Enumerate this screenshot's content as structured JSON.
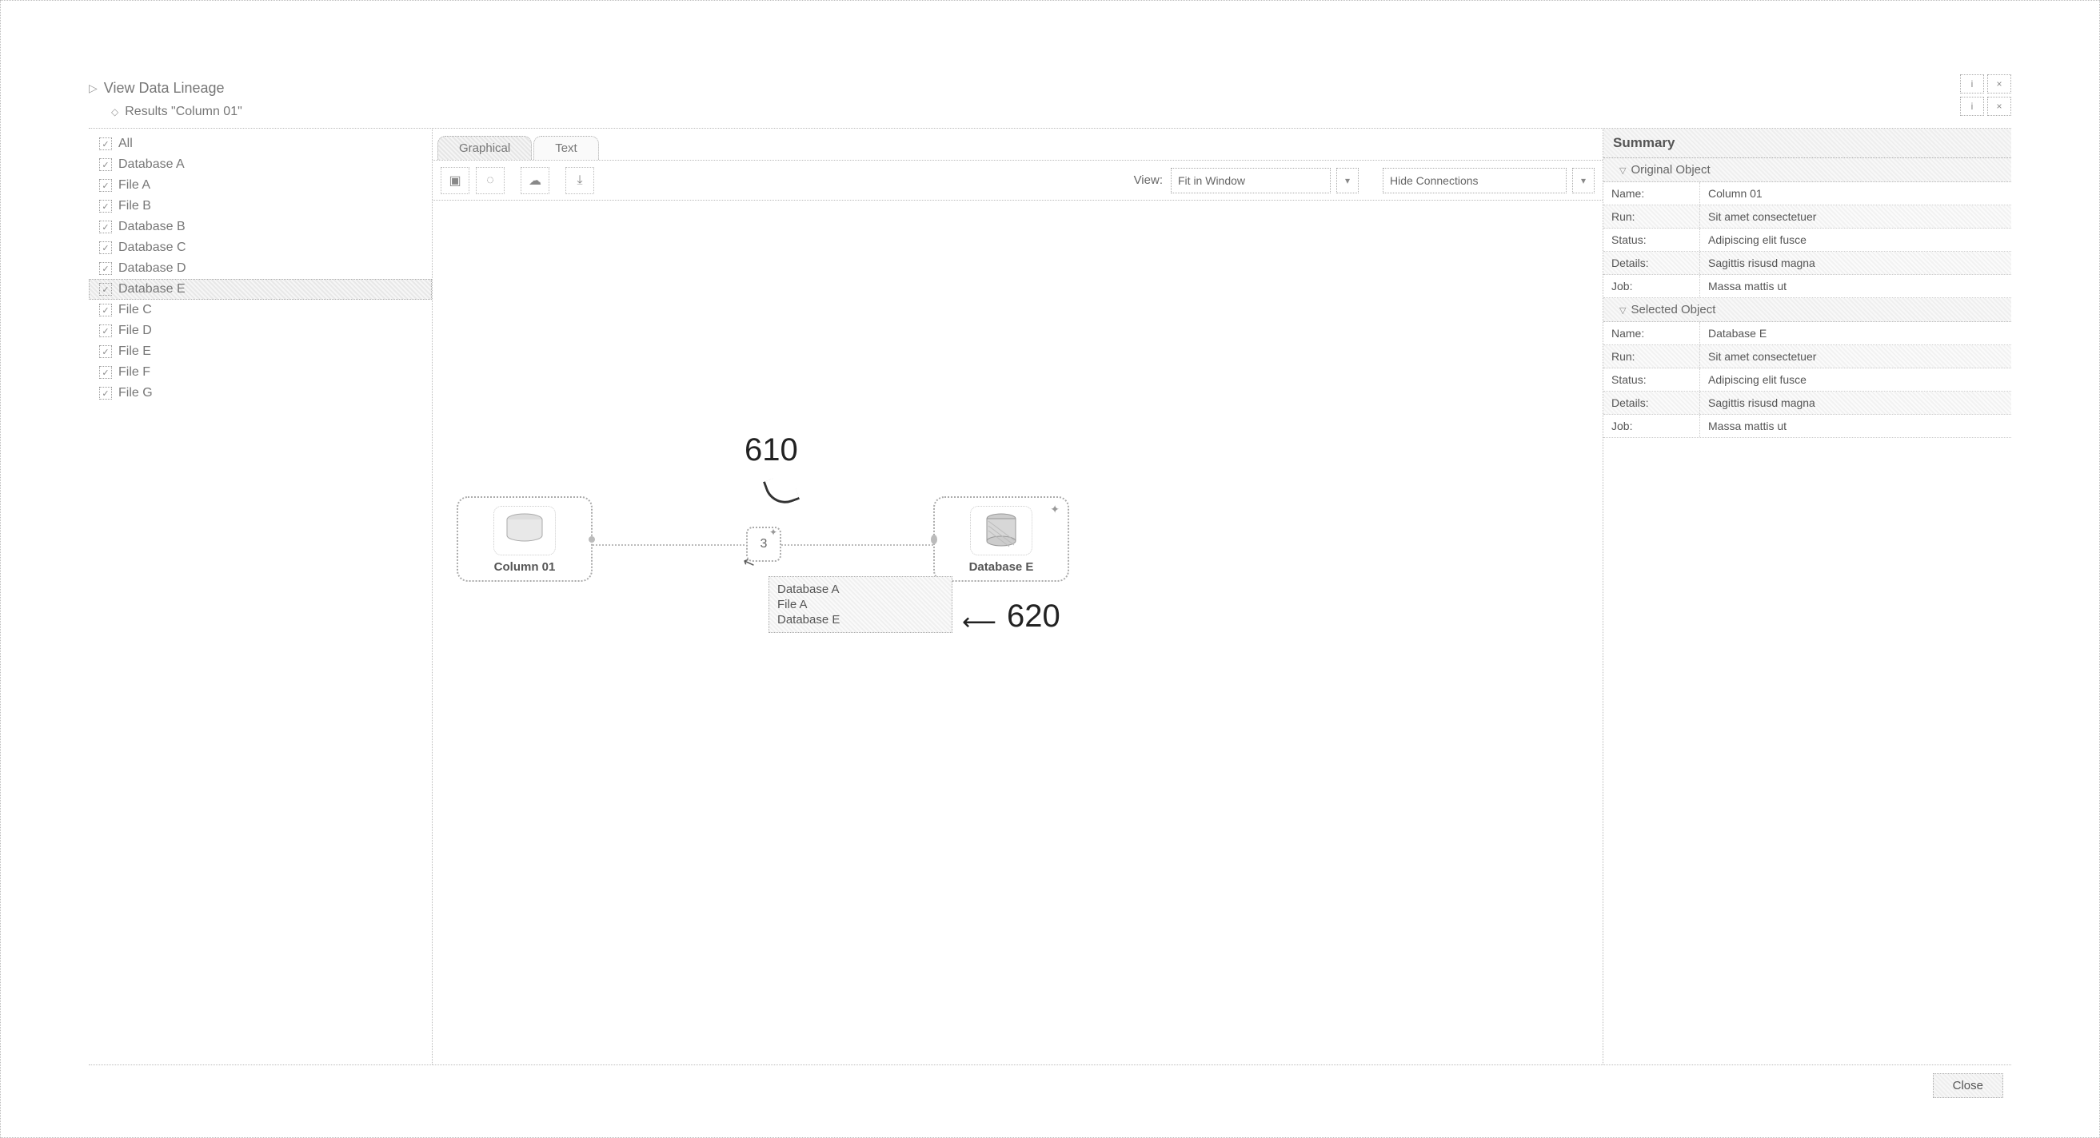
{
  "header": {
    "title": "View Data Lineage",
    "subtitle": "Results \"Column 01\"",
    "info_label": "i",
    "close_label": "×"
  },
  "sidebar": {
    "items": [
      {
        "label": "All",
        "checked": true,
        "selected": false
      },
      {
        "label": "Database A",
        "checked": true,
        "selected": false
      },
      {
        "label": "File A",
        "checked": true,
        "selected": false
      },
      {
        "label": "File B",
        "checked": true,
        "selected": false
      },
      {
        "label": "Database B",
        "checked": true,
        "selected": false
      },
      {
        "label": "Database C",
        "checked": true,
        "selected": false
      },
      {
        "label": "Database D",
        "checked": true,
        "selected": false
      },
      {
        "label": "Database E",
        "checked": true,
        "selected": true
      },
      {
        "label": "File C",
        "checked": true,
        "selected": false
      },
      {
        "label": "File D",
        "checked": true,
        "selected": false
      },
      {
        "label": "File E",
        "checked": true,
        "selected": false
      },
      {
        "label": "File F",
        "checked": true,
        "selected": false
      },
      {
        "label": "File G",
        "checked": true,
        "selected": false
      }
    ]
  },
  "tabs": {
    "graphical": "Graphical",
    "text": "Text"
  },
  "toolbar": {
    "view_label": "View:",
    "view_value": "Fit in Window",
    "hide_conn_label": "Hide Connections"
  },
  "graph": {
    "node_left_label": "Column 01",
    "hop_count": "3",
    "node_right_label": "Database E",
    "popup_items": [
      "Database A",
      "File A",
      "Database E"
    ]
  },
  "callouts": {
    "c1": "610",
    "c2": "620"
  },
  "summary": {
    "title": "Summary",
    "original_heading": "Original Object",
    "selected_heading": "Selected Object",
    "labels": {
      "name": "Name:",
      "run": "Run:",
      "status": "Status:",
      "details": "Details:",
      "job": "Job:"
    },
    "original": {
      "name": "Column 01",
      "run": "Sit amet consectetuer",
      "status": "Adipiscing elit fusce",
      "details": "Sagittis risusd magna",
      "job": "Massa mattis ut"
    },
    "selected": {
      "name": "Database E",
      "run": "Sit amet consectetuer",
      "status": "Adipiscing elit fusce",
      "details": "Sagittis risusd magna",
      "job": "Massa mattis ut"
    }
  },
  "footer": {
    "close_label": "Close"
  }
}
